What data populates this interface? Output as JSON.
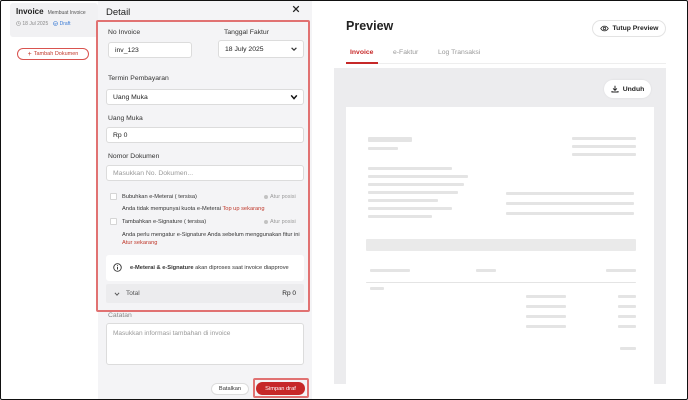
{
  "list": {
    "invoice_title": "Invoice",
    "invoice_subtitle": "Membuat Invoice",
    "invoice_date": "18 Jul 2025",
    "invoice_status": "Draft",
    "add_document_label": "Tambah Dokumen"
  },
  "drawer": {
    "title": "Detail",
    "invoice_no_label": "No Invoice",
    "invoice_no_value": "inv_123",
    "invoice_date_label": "Tanggal Faktur",
    "invoice_date_value": "18 July 2025",
    "payment_term_label": "Termin Pembayaran",
    "payment_term_value": "Uang Muka",
    "down_payment_label": "Uang Muka",
    "down_payment_value": "Rp 0",
    "doc_number_label": "Nomor Dokumen",
    "doc_number_placeholder": "Masukkan No. Dokumen...",
    "emeterai_label": "Bubuhkan e-Meterai ( tersisa)",
    "emeterai_position": "Atur posisi",
    "emeterai_note": "Anda tidak mempunyai kuota e-Meterai",
    "emeterai_link": "Top up sekarang",
    "esign_label": "Tambahkan e-Signature ( tersisa)",
    "esign_position": "Atur posisi",
    "esign_note": "Anda perlu mengatur e-Signature Anda sebelum menggunakan fitur ini",
    "esign_link": "Atur sekarang",
    "info_bold": "e-Meterai & e-Signature",
    "info_rest": " akan diproses saat invoice diapprove",
    "total_label": "Total",
    "total_value": "Rp 0",
    "notes_label": "Catatan",
    "notes_placeholder": "Masukkan informasi tambahan di invoice",
    "cancel_label": "Batalkan",
    "save_label": "Simpan draf"
  },
  "preview": {
    "title": "Preview",
    "close_label": "Tutup Preview",
    "tabs": [
      {
        "label": "Invoice"
      },
      {
        "label": "e-Faktur"
      },
      {
        "label": "Log Transaksi"
      }
    ],
    "download_label": "Unduh"
  },
  "colors": {
    "accent": "#c62828",
    "highlight": "#e17272",
    "drawer_bg": "#f4f4f6",
    "viewer_bg": "#ececee"
  },
  "icons": [
    "check-circle-icon",
    "plus-icon",
    "close-icon",
    "chevron-down-icon",
    "info-icon",
    "eye-icon",
    "download-icon"
  ]
}
